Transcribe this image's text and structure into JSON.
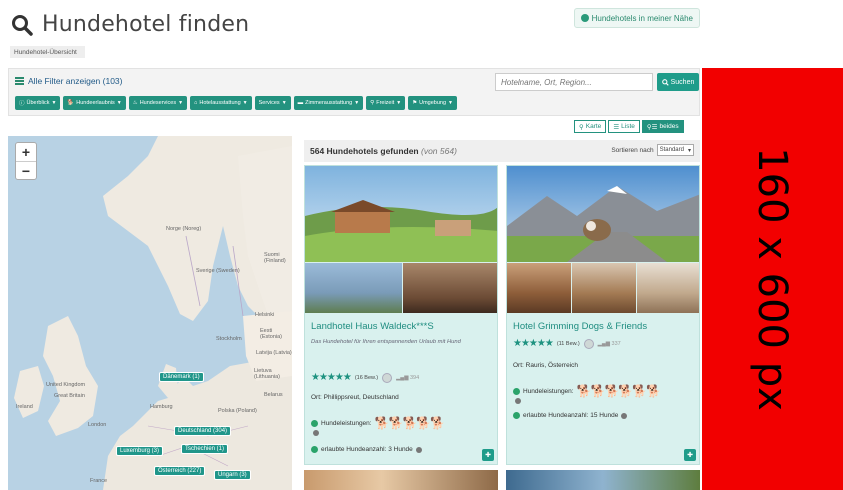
{
  "header": {
    "title": "Hundehotel finden",
    "near_button": "Hundehotels in meiner Nähe"
  },
  "breadcrumb": "Hundehotel-Übersicht",
  "filters": {
    "all_filters": "Alle Filter anzeigen (103)",
    "search_placeholder": "Hotelname, Ort, Region...",
    "search_button": "Suchen",
    "chips": [
      "Überblick",
      "Hundeerlaubnis",
      "Hundeservices",
      "Hotelausstattung",
      "Services",
      "Zimmerausstattung",
      "Freizeit",
      "Umgebung"
    ]
  },
  "view_toggle": {
    "karte": "Karte",
    "liste": "Liste",
    "beides": "beides"
  },
  "map": {
    "zoom_in": "+",
    "zoom_out": "−",
    "labels": [
      "Norge (Noreg)",
      "Sverige (Sweden)",
      "Suomi (Finland)",
      "Helsinki",
      "Stockholm",
      "Eesti (Estonia)",
      "Latvija (Latvia)",
      "Lietuva (Lithuania)",
      "United Kingdom",
      "Great Britain",
      "London",
      "Ireland",
      "Hamburg",
      "Polska (Poland)",
      "France",
      "Belarus"
    ],
    "clusters": [
      "Dänemark (1)",
      "Deutschland (304)",
      "Luxemburg (3)",
      "Tschechien (1)",
      "Österreich (227)",
      "Ungarn (3)"
    ]
  },
  "results": {
    "count": "564 Hundehotels gefunden",
    "of": "(von 564)",
    "sort_label": "Sortieren nach",
    "sort_value": "Standard"
  },
  "cards": [
    {
      "title": "Landhotel Haus Waldeck***S",
      "description": "Das Hundehotel für Ihren entspannenden Urlaub mit Hund",
      "rating_stars": "★★★★★",
      "reviews": "(16 Bew.)",
      "views": "394",
      "location": "Ort: Phillippsreut, Deutschland",
      "services_label": "Hundeleistungen:",
      "dogs_allowed": "erlaubte Hundeanzahl: 3 Hunde"
    },
    {
      "title": "Hotel Grimming Dogs & Friends",
      "description": "",
      "rating_stars": "★★★★★",
      "reviews": "(11 Bew.)",
      "views": "337",
      "location": "Ort: Rauris, Österreich",
      "services_label": "Hundeleistungen:",
      "dogs_allowed": "erlaubte Hundeanzahl: 15 Hunde"
    }
  ],
  "ad": {
    "text": "160 x 600 px",
    "color": "#f20000"
  },
  "colors": {
    "accent": "#23927f",
    "card_bg": "#d9f1ee",
    "link": "#225b88"
  }
}
